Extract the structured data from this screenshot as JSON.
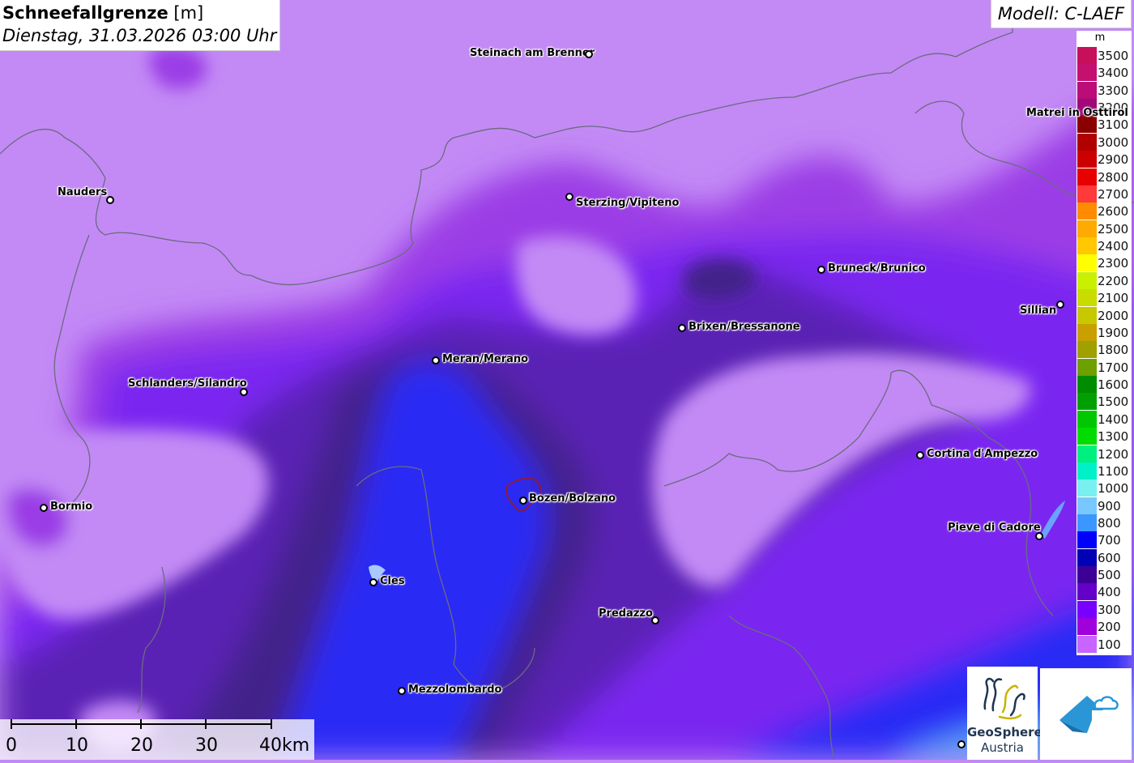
{
  "header": {
    "title": "Schneefallgrenze",
    "unit": "[m]",
    "datetime": "Dienstag, 31.03.2026 03:00 Uhr"
  },
  "model_label": "Modell: C-LAEF",
  "legend": {
    "unit": "m",
    "entries": [
      {
        "label": "3500",
        "color": "#c8105a"
      },
      {
        "label": "3400",
        "color": "#c4106e"
      },
      {
        "label": "3300",
        "color": "#bb0c78"
      },
      {
        "label": "3200",
        "color": "#a00a78"
      },
      {
        "label": "3100",
        "color": "#8a0000"
      },
      {
        "label": "3000",
        "color": "#b00000"
      },
      {
        "label": "2900",
        "color": "#cc0000"
      },
      {
        "label": "2800",
        "color": "#e80000"
      },
      {
        "label": "2700",
        "color": "#ff3a3a"
      },
      {
        "label": "2600",
        "color": "#ff8c00"
      },
      {
        "label": "2500",
        "color": "#ffaa00"
      },
      {
        "label": "2400",
        "color": "#ffc800"
      },
      {
        "label": "2300",
        "color": "#ffff00"
      },
      {
        "label": "2200",
        "color": "#c8f000"
      },
      {
        "label": "2100",
        "color": "#c8dc00"
      },
      {
        "label": "2000",
        "color": "#c8c800"
      },
      {
        "label": "1900",
        "color": "#c8a000"
      },
      {
        "label": "1800",
        "color": "#a0a000"
      },
      {
        "label": "1700",
        "color": "#6ea000"
      },
      {
        "label": "1600",
        "color": "#008c00"
      },
      {
        "label": "1500",
        "color": "#00a000"
      },
      {
        "label": "1400",
        "color": "#00c800"
      },
      {
        "label": "1300",
        "color": "#00dc00"
      },
      {
        "label": "1200",
        "color": "#00f080"
      },
      {
        "label": "1100",
        "color": "#00f0c8"
      },
      {
        "label": "1000",
        "color": "#78f0f0"
      },
      {
        "label": "900",
        "color": "#78c8ff"
      },
      {
        "label": "800",
        "color": "#3c96ff"
      },
      {
        "label": "700",
        "color": "#0000ff"
      },
      {
        "label": "600",
        "color": "#0000b4"
      },
      {
        "label": "500",
        "color": "#3c0096"
      },
      {
        "label": "400",
        "color": "#6400c8"
      },
      {
        "label": "300",
        "color": "#7800ff"
      },
      {
        "label": "200",
        "color": "#a000dc"
      },
      {
        "label": "100",
        "color": "#c864ff"
      }
    ]
  },
  "cities": [
    {
      "id": "steinach",
      "name": "Steinach am Brenner"
    },
    {
      "id": "matrei",
      "name": "Matrei in Osttirol"
    },
    {
      "id": "nauders",
      "name": "Nauders"
    },
    {
      "id": "sterzing",
      "name": "Sterzing/Vipiteno"
    },
    {
      "id": "bruneck",
      "name": "Bruneck/Brunico"
    },
    {
      "id": "sillian",
      "name": "Sillian"
    },
    {
      "id": "brixen",
      "name": "Brixen/Bressanone"
    },
    {
      "id": "meran",
      "name": "Meran/Merano"
    },
    {
      "id": "schlanders",
      "name": "Schlanders/Silandro"
    },
    {
      "id": "cortina",
      "name": "Cortina d'Ampezzo"
    },
    {
      "id": "bormio",
      "name": "Bormio"
    },
    {
      "id": "bozen",
      "name": "Bozen/Bolzano"
    },
    {
      "id": "pieve",
      "name": "Pieve di Cadore"
    },
    {
      "id": "cles",
      "name": "Cles"
    },
    {
      "id": "predazzo",
      "name": "Predazzo"
    },
    {
      "id": "mezzolombardo",
      "name": "Mezzolombardo"
    }
  ],
  "scale_bar": {
    "ticks": [
      "0",
      "10",
      "20",
      "30",
      "40km"
    ]
  },
  "logos": {
    "geosphere_name": "GeoSphere",
    "geosphere_sub": "Austria"
  }
}
